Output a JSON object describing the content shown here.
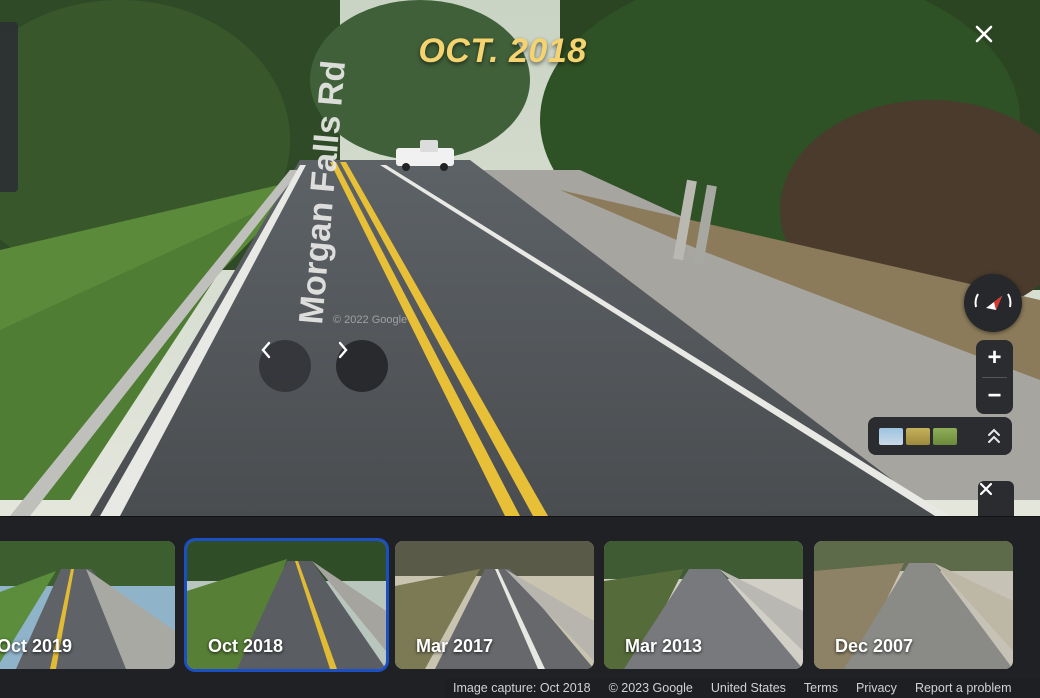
{
  "overlay": {
    "title": "OCT. 2018"
  },
  "street": {
    "name": "Morgan Falls Rd",
    "watermark": "© 2022 Google"
  },
  "controls": {
    "close_icon": "close-icon",
    "prev_icon": "chevron-left-icon",
    "next_icon": "chevron-right-icon",
    "zoom_in": "+",
    "zoom_out": "−",
    "compass_icon": "compass-icon",
    "layers_expand_icon": "chevron-double-up-icon"
  },
  "timeline": {
    "items": [
      {
        "label": "Oct 2019",
        "selected": false
      },
      {
        "label": "Oct 2018",
        "selected": true
      },
      {
        "label": "Mar 2017",
        "selected": false
      },
      {
        "label": "Mar 2013",
        "selected": false
      },
      {
        "label": "Dec 2007",
        "selected": false
      }
    ]
  },
  "footer": {
    "capture": "Image capture: Oct 2018",
    "copyright": "© 2023 Google",
    "country": "United States",
    "terms": "Terms",
    "privacy": "Privacy",
    "report": "Report a problem"
  },
  "colors": {
    "accent_selected": "#1a4fc5",
    "title_yellow": "#f5d36e",
    "panel": "#202124"
  }
}
